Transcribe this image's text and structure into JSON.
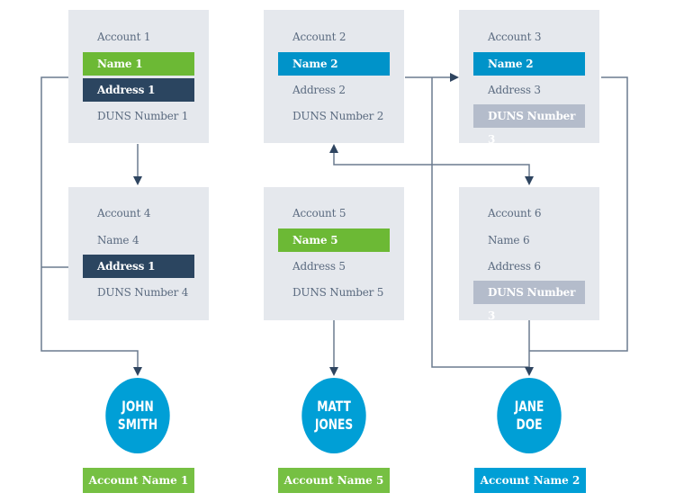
{
  "colors": {
    "card_bg": "#e5e8ed",
    "green": "#6cb935",
    "navy": "#2b4560",
    "blue": "#0093c9",
    "gray": "#b4bccb",
    "line": "#3d5068",
    "circle": "#009fd6"
  },
  "accounts": [
    {
      "rows": [
        {
          "text": "Account 1",
          "style": "plain"
        },
        {
          "text": "Name 1",
          "style": "green"
        },
        {
          "text": "Address 1",
          "style": "navy"
        },
        {
          "text": "DUNS Number 1",
          "style": "plain"
        }
      ]
    },
    {
      "rows": [
        {
          "text": "Account 2",
          "style": "plain"
        },
        {
          "text": "Name 2",
          "style": "blue"
        },
        {
          "text": "Address 2",
          "style": "plain"
        },
        {
          "text": "DUNS Number 2",
          "style": "plain"
        }
      ]
    },
    {
      "rows": [
        {
          "text": "Account 3",
          "style": "plain"
        },
        {
          "text": "Name 2",
          "style": "blue"
        },
        {
          "text": "Address 3",
          "style": "plain"
        },
        {
          "text": "DUNS Number 3",
          "style": "gray"
        }
      ]
    },
    {
      "rows": [
        {
          "text": "Account 4",
          "style": "plain"
        },
        {
          "text": "Name 4",
          "style": "plain"
        },
        {
          "text": "Address 1",
          "style": "navy"
        },
        {
          "text": "DUNS Number 4",
          "style": "plain"
        }
      ]
    },
    {
      "rows": [
        {
          "text": "Account 5",
          "style": "plain"
        },
        {
          "text": "Name 5",
          "style": "green"
        },
        {
          "text": "Address 5",
          "style": "plain"
        },
        {
          "text": "DUNS Number 5",
          "style": "plain"
        }
      ]
    },
    {
      "rows": [
        {
          "text": "Account 6",
          "style": "plain"
        },
        {
          "text": "Name 6",
          "style": "plain"
        },
        {
          "text": "Address 6",
          "style": "plain"
        },
        {
          "text": "DUNS Number 3",
          "style": "gray"
        }
      ]
    }
  ],
  "people": [
    {
      "first": "JOHN",
      "last": "SMITH",
      "account_label": "Account Name 1",
      "label_style": "green"
    },
    {
      "first": "MATT",
      "last": "JONES",
      "account_label": "Account Name 5",
      "label_style": "green"
    },
    {
      "first": "JANE",
      "last": "DOE",
      "account_label": "Account Name 2",
      "label_style": "blue"
    }
  ]
}
